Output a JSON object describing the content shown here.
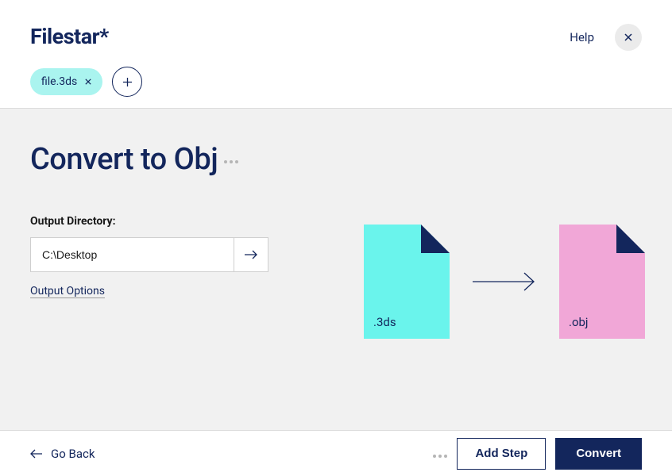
{
  "header": {
    "logo": "Filestar",
    "help_label": "Help",
    "file_chip": "file.3ds"
  },
  "main": {
    "title": "Convert to Obj",
    "output_directory_label": "Output Directory:",
    "output_directory_value": "C:\\Desktop",
    "output_options_label": "Output Options",
    "source_ext": ".3ds",
    "target_ext": ".obj"
  },
  "footer": {
    "go_back_label": "Go Back",
    "add_step_label": "Add Step",
    "convert_label": "Convert"
  }
}
